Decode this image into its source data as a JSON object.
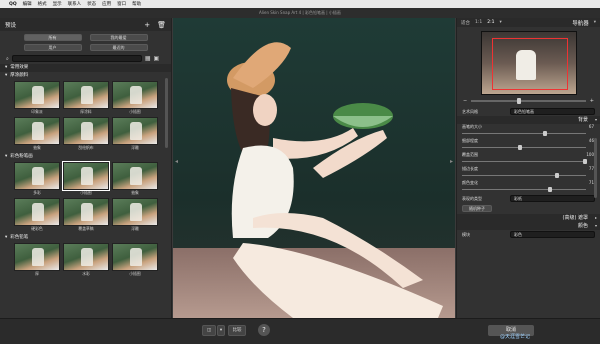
{
  "menubar": {
    "app": "QQ",
    "items": [
      "编辑",
      "格式",
      "显示",
      "联系人",
      "状态",
      "应用",
      "窗口",
      "帮助"
    ],
    "clock": "星期四 02:43"
  },
  "window": {
    "title": "Alien Skin Snap Art 4 | 彩色铅笔画 | 小插画"
  },
  "left_panel": {
    "header": "预设",
    "filters": [
      "所有",
      "我的最爱",
      "用户",
      "最近的"
    ],
    "search_placeholder": "",
    "tree_root": "常用效果",
    "sections": [
      {
        "title": "厚涂颜料",
        "items": [
          "印象派",
          "厚涂料",
          "小插图",
          "抽象",
          "刮绘帆布",
          "浮雕"
        ]
      },
      {
        "title": "彩色粉笔画",
        "items": [
          "多彩",
          "小插图",
          "抽象",
          "硬彩色",
          "覆盖草稿",
          "浮雕"
        ]
      },
      {
        "title": "彩色铅笔",
        "items": [
          "厚",
          "水彩",
          "小插图"
        ]
      }
    ]
  },
  "right_panel": {
    "zoom_modes": [
      "适合",
      "1:1",
      "2:1"
    ],
    "nav_title": "导航器",
    "style_label": "艺术风格",
    "style_value": "彩色铅笔画",
    "background_title": "背景",
    "sliders": [
      {
        "label": "画笔的大小",
        "value": "67",
        "pct": 0.67
      },
      {
        "label": "细部程度",
        "value": "46",
        "pct": 0.46
      },
      {
        "label": "覆盖范围",
        "value": "100",
        "pct": 1.0
      },
      {
        "label": "描边长度",
        "value": "77",
        "pct": 0.77
      },
      {
        "label": "颜色变化",
        "value": "71",
        "pct": 0.71
      }
    ],
    "paper_label": "表现的类型",
    "paper_value": "彩纸",
    "random_seed_btn": "随机种子",
    "advanced_title": "(高级) 遮罩",
    "color_title": "颜色",
    "color_mode_label": "模块",
    "color_mode_value": "彩色"
  },
  "bottom": {
    "compare_label": "比较",
    "help": "?",
    "apply_label": "取消",
    "watermark": "@天涯雪芒记"
  }
}
